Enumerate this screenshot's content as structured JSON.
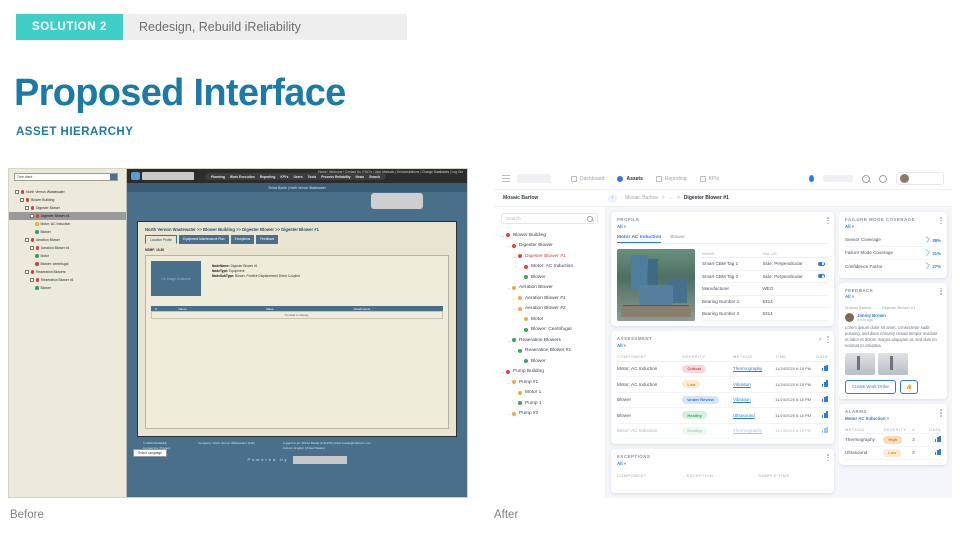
{
  "slide": {
    "badge": "SOLUTION 2",
    "solution_title": "Redesign, Rebuild iReliability",
    "title": "Proposed Interface",
    "subtitle": "ASSET HIERARCHY",
    "caption_before": "Before",
    "caption_after": "After",
    "accent_teal": "#3fcfc8",
    "accent_blue": "#1b7aa8"
  },
  "before": {
    "tree_select": "Tree Ident",
    "tree": [
      {
        "label": "North Vernon Wastewater",
        "depth": 0,
        "dot": "#d23f3f",
        "box": true
      },
      {
        "label": "Blower Building",
        "depth": 1,
        "dot": "#d23f3f",
        "box": true
      },
      {
        "label": "Digester Blower",
        "depth": 2,
        "dot": "#d23f3f",
        "box": true
      },
      {
        "label": "Digester Blower #1",
        "depth": 3,
        "dot": "#d23f3f",
        "box": true,
        "selected": true
      },
      {
        "label": "Motor: AC Induction",
        "depth": 4,
        "dot": "#e6b422",
        "box": false
      },
      {
        "label": "Blower",
        "depth": 4,
        "dot": "#3a9e63",
        "box": false
      },
      {
        "label": "Aeration Blower",
        "depth": 2,
        "dot": "#d23f3f",
        "box": true
      },
      {
        "label": "Aeration Blower #1",
        "depth": 3,
        "dot": "#d23f3f",
        "box": true
      },
      {
        "label": "Motor",
        "depth": 4,
        "dot": "#3a9e63",
        "box": false
      },
      {
        "label": "Blower: centrifugal",
        "depth": 4,
        "dot": "#d23f3f",
        "box": false
      },
      {
        "label": "Reaeration Blowers",
        "depth": 2,
        "dot": "#d23f3f",
        "box": true
      },
      {
        "label": "Reaeration Blower #1",
        "depth": 3,
        "dot": "#d23f3f",
        "box": true
      },
      {
        "label": "Blower",
        "depth": 4,
        "dot": "#3a9e63",
        "box": false
      }
    ],
    "toplinks": "Home  |  Welcome  |  Contact Us  |  FAQ's  |  User Manuals  |  Demonstrations  |  Change Databases  |  Log Out",
    "menu": [
      "Planning",
      "Work Execution",
      "Reporting",
      "KPI's",
      "Users",
      "Tools",
      "Process Reliability",
      "News",
      "Search"
    ],
    "userbar": "Shiraz Baxile | North Vernon Wastewater",
    "breadcrumb": "North Vernon Wastewater >> Blower Building >> Digester Blower >> Digester Blower #1",
    "tabs": [
      "Location Profile",
      "Equipment Maintenance Plan",
      "Exceptions",
      "Feedback"
    ],
    "mdbf": "MDBF: 16.80",
    "thumb_caption": "No Image Available",
    "meta": [
      {
        "k": "NodeName:",
        "v": "Digester Blower #1"
      },
      {
        "k": "NodeType:",
        "v": "Equipment"
      },
      {
        "k": "NodeSubType:",
        "v": "Blower, Positive Displacement Direct Coupled"
      }
    ],
    "grid_headers": [
      "#",
      "Name",
      "Value",
      "Attachments"
    ],
    "grid_empty": "No data to display.",
    "footer_left": "© 2020 iReliability\nContact Us | Privacy",
    "footer_mid": "Company: North Vernon Wastewater (418)",
    "footer_right": "Logged in as: Shiraz Baxile (br11370) shiraz.baxile@chatonic.com\nCulture: English (United States)",
    "powered": "Powered by",
    "language": "Select Language"
  },
  "after": {
    "nav": [
      {
        "label": "Dashboard",
        "icon": "grid-icon",
        "active": false
      },
      {
        "label": "Assets",
        "icon": "assets-icon",
        "active": true
      },
      {
        "label": "Reporting",
        "icon": "report-icon",
        "active": false
      },
      {
        "label": "KPIs",
        "icon": "kpi-icon",
        "active": false
      }
    ],
    "site": "Mosaic Bartow",
    "breadcrumb": [
      "Mosaic Bartow",
      "...",
      "Digester Blower #1"
    ],
    "search_placeholder": "Search",
    "tree": [
      {
        "label": "Blower Building",
        "depth": 0,
        "dot": "#e0443d",
        "chev": "v"
      },
      {
        "label": "Digester Blower",
        "depth": 1,
        "dot": "#e0443d",
        "chev": "v"
      },
      {
        "label": "Digester Blower #1",
        "depth": 2,
        "dot": "#e0443d",
        "chev": "v",
        "active": true
      },
      {
        "label": "Motor: AC Induction",
        "depth": 3,
        "dot": "#e0443d",
        "chev": ""
      },
      {
        "label": "Blower",
        "depth": 3,
        "dot": "#34a853",
        "chev": ""
      },
      {
        "label": "Aeration Blower",
        "depth": 1,
        "dot": "#f2a93b",
        "chev": "v"
      },
      {
        "label": "Aeration Blower #1",
        "depth": 2,
        "dot": "#f2a93b",
        "chev": ">"
      },
      {
        "label": "Aeration Blower #2",
        "depth": 2,
        "dot": "#f2a93b",
        "chev": "v"
      },
      {
        "label": "Motor",
        "depth": 3,
        "dot": "#f2a93b",
        "chev": ""
      },
      {
        "label": "Blower: Centrifugal",
        "depth": 3,
        "dot": "#34a853",
        "chev": ""
      },
      {
        "label": "Reaeration Blowers",
        "depth": 1,
        "dot": "#34a853",
        "chev": "v"
      },
      {
        "label": "Reaeration Blower #1",
        "depth": 2,
        "dot": "#34a853",
        "chev": "v"
      },
      {
        "label": "Blower",
        "depth": 3,
        "dot": "#34a853",
        "chev": ""
      },
      {
        "label": "Pump Building",
        "depth": 0,
        "dot": "#e0443d",
        "chev": "v"
      },
      {
        "label": "Pump #1",
        "depth": 1,
        "dot": "#f2a93b",
        "chev": "v"
      },
      {
        "label": "Motor 1",
        "depth": 2,
        "dot": "#f2a93b",
        "chev": ""
      },
      {
        "label": "Pump 1",
        "depth": 2,
        "dot": "#34a853",
        "chev": ""
      },
      {
        "label": "Pump #2",
        "depth": 1,
        "dot": "#f2a93b",
        "chev": "v"
      }
    ],
    "profile": {
      "title": "PROFILE",
      "filter": "All",
      "tabs": [
        {
          "label": "Motor AC Induction",
          "active": true
        },
        {
          "label": "Blower",
          "active": false
        }
      ],
      "columns": [
        "NAME",
        "VALUE"
      ],
      "rows": [
        {
          "name": "Smart CBM Tag 1",
          "value": "Side: Perpendicular",
          "toggle": true
        },
        {
          "name": "Smart CBM Tag 2",
          "value": "Side: Perpendicular",
          "toggle": true
        },
        {
          "name": "Manufacturer",
          "value": "WEG",
          "toggle": false
        },
        {
          "name": "Bearing Number 1",
          "value": "6314",
          "toggle": false
        },
        {
          "name": "Bearing Number 2",
          "value": "6314",
          "toggle": false
        }
      ]
    },
    "assessment": {
      "title": "ASSESSMENT",
      "filter": "All",
      "columns": [
        "COMPONENT",
        "SEVERITY",
        "METHOD",
        "TIME",
        "DATA"
      ],
      "rows": [
        {
          "component": "Motor: AC Induction",
          "severity": "Critical",
          "severity_class": "p-critical",
          "method": "Thermography",
          "time": "11/24/2020 6:18 PM"
        },
        {
          "component": "Motor: AC Induction",
          "severity": "Low",
          "severity_class": "p-low",
          "method": "Vibration",
          "time": "11/24/2020 6:18 PM"
        },
        {
          "component": "Blower",
          "severity": "Under Review",
          "severity_class": "p-review",
          "method": "Vibration",
          "time": "11/24/2020 6:18 PM"
        },
        {
          "component": "Blower",
          "severity": "Healthy",
          "severity_class": "p-healthy",
          "method": "Ultrasound",
          "time": "11/24/2020 6:18 PM"
        },
        {
          "component": "Motor: AC Induction",
          "severity": "Healthy",
          "severity_class": "p-healthy",
          "method": "Thermography",
          "time": "11/24/2020 6:18 PM",
          "fade": true
        }
      ]
    },
    "exceptions": {
      "title": "EXCEPTIONS",
      "filter": "All",
      "columns": [
        "COMPONENT",
        "EXCEPTION",
        "SAMPLE TIME"
      ]
    },
    "coverage": {
      "title": "FAILURE MODE COVERAGE",
      "filter": "All",
      "rows": [
        {
          "label": "Sensor Coverage",
          "value": "38%"
        },
        {
          "label": "Failure Mode Coverage",
          "value": "31%"
        },
        {
          "label": "Confidence Factor",
          "value": "27%"
        }
      ]
    },
    "feedback": {
      "title": "FEEDBACK",
      "filter": "All",
      "context": "Mosaic Bartow  -  ...  -  Digester Blower #1",
      "author": "Jimmy Brown",
      "ago": "5 min ago",
      "text": "Lorem ipsum dolor sit amet, consectetur sadit posuing, sed diam nonumy nimad tempor invidunt ut labor et dolore magna aliquyam at, sed duis no nonmat et voluptua.",
      "create_work_order": "Create Work Order",
      "like_icon": "thumbs-up-icon"
    },
    "alarms": {
      "title": "ALARMS",
      "filter": "Motor AC Induction",
      "columns": [
        "METHOD",
        "SEVERITY",
        "#",
        "DATA"
      ],
      "rows": [
        {
          "method": "Thermography",
          "severity": "High",
          "severity_class": "p-high",
          "count": "2"
        },
        {
          "method": "Ultrasound",
          "severity": "Low",
          "severity_class": "p-low",
          "count": "2"
        }
      ]
    }
  }
}
